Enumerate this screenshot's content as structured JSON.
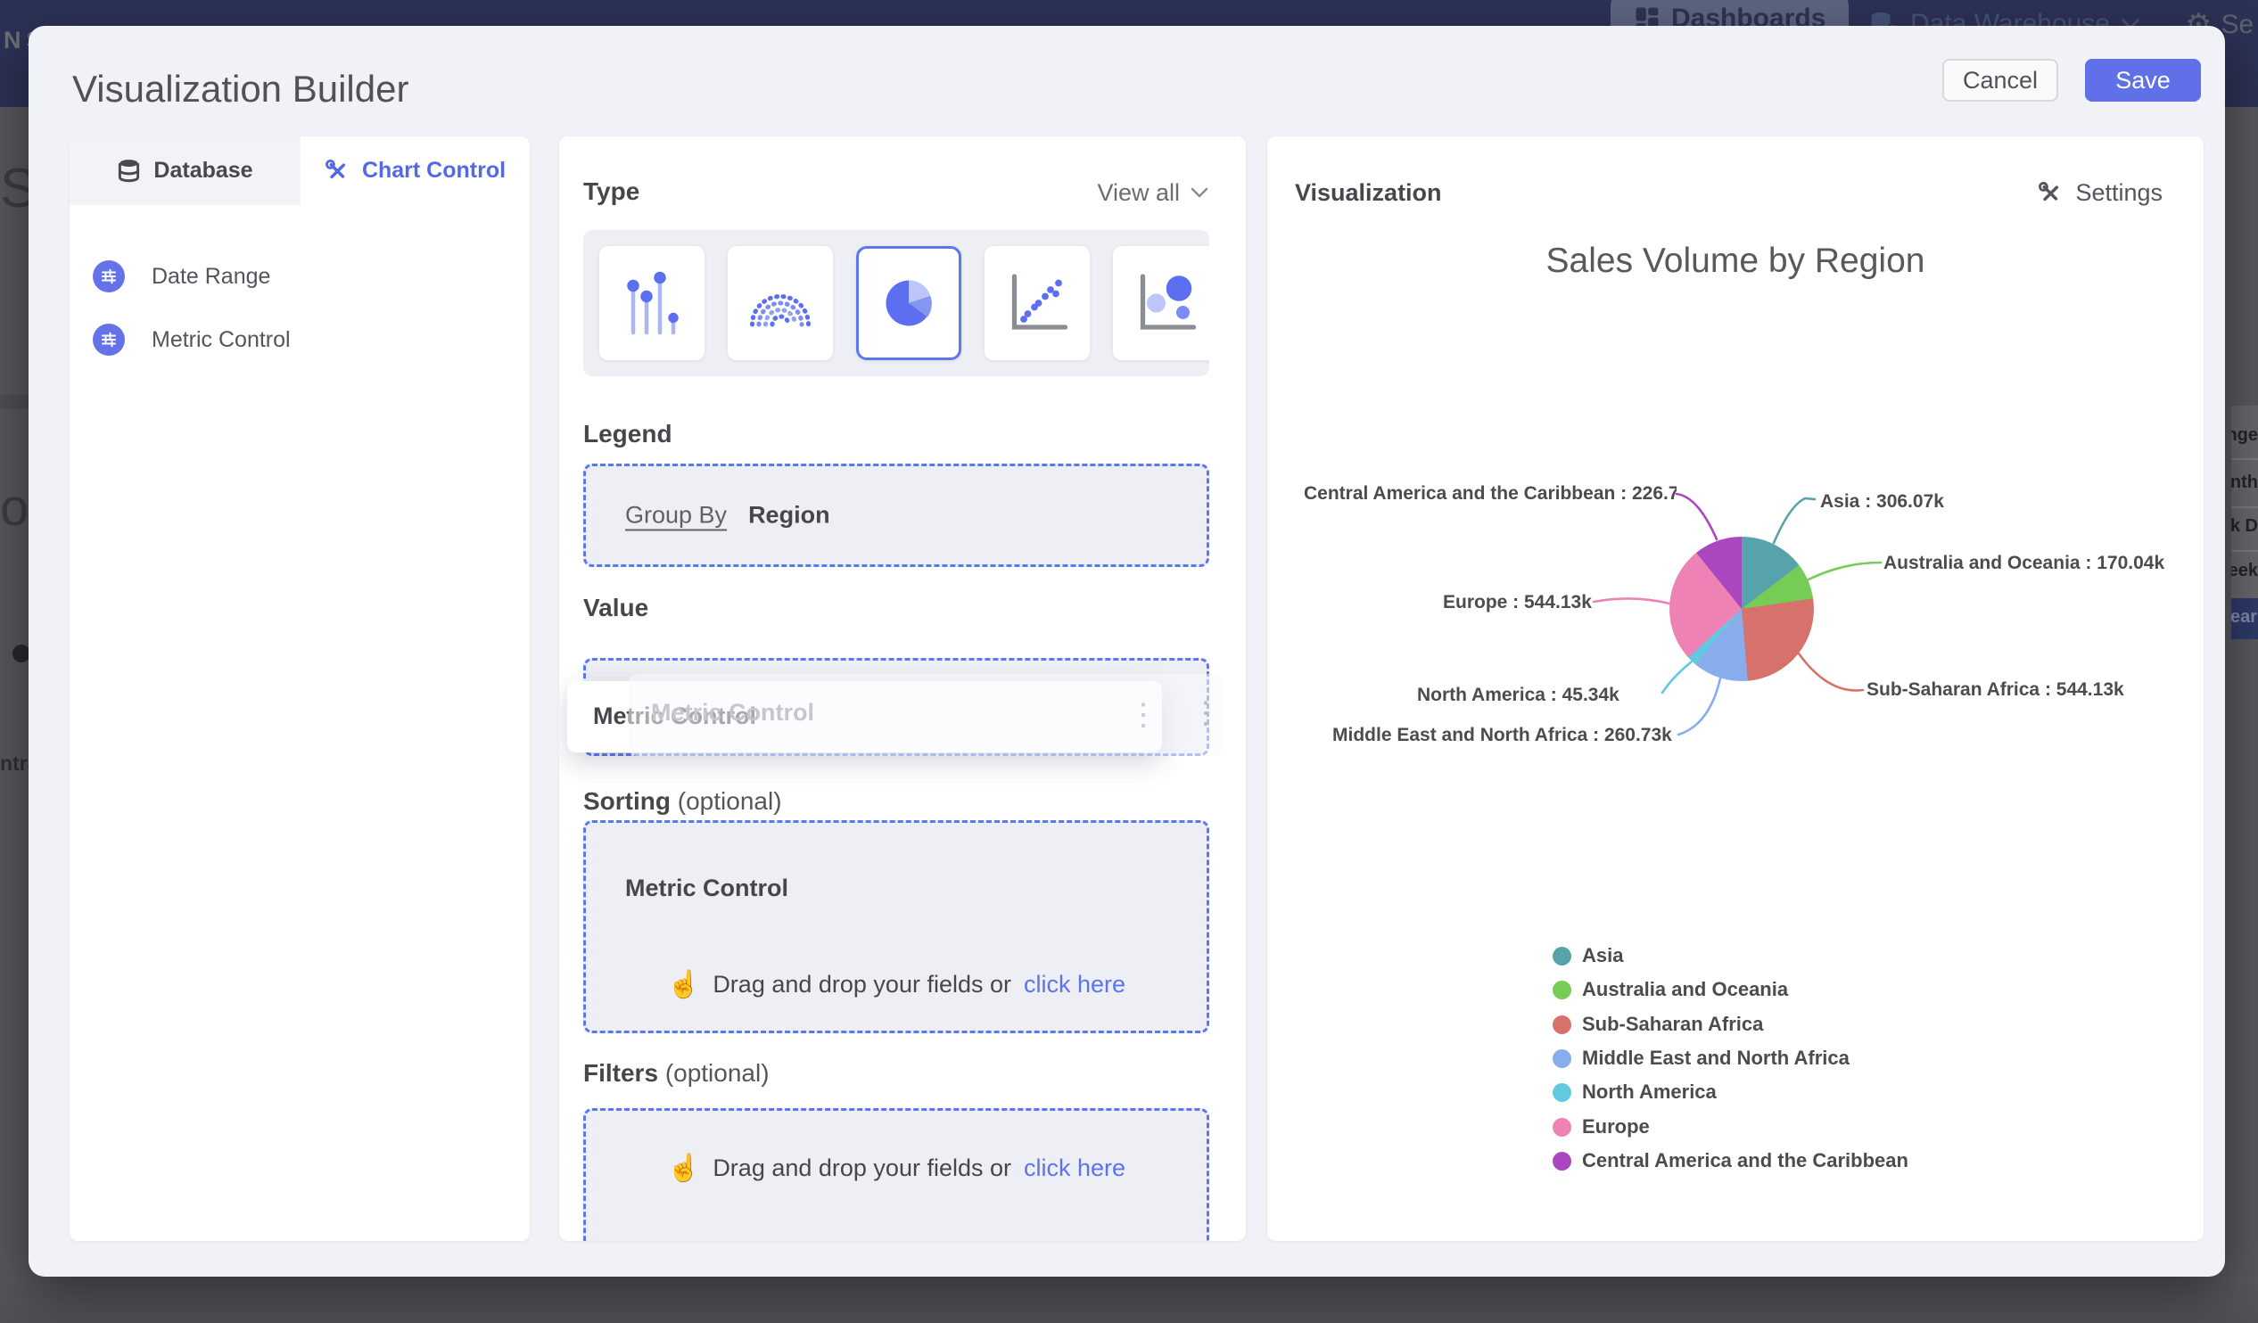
{
  "nav": {
    "brand": "NSIDER",
    "dashboards_label": "Dashboards",
    "data_warehouse_label": "Data Warehouse",
    "settings_partial": "Se"
  },
  "backdrop": {
    "fragment_top": "Sal",
    "fragment_mid": "ota",
    "fragment_bottom": "ntral",
    "right_menu_items": [
      "nge",
      "nth",
      "k D",
      "eek"
    ],
    "right_menu_selected": "ear"
  },
  "modal": {
    "title": "Visualization Builder",
    "cancel_label": "Cancel",
    "save_label": "Save"
  },
  "builder": {
    "tabs": [
      {
        "label": "Database",
        "active": false
      },
      {
        "label": "Chart Control",
        "active": true
      }
    ],
    "controls": [
      {
        "label": "Date Range"
      },
      {
        "label": "Metric Control"
      }
    ],
    "type": {
      "heading": "Type",
      "view_all": "View all",
      "options": [
        "lollipop",
        "arc-of-dots",
        "pie",
        "scatter",
        "bubble"
      ],
      "selected": "pie"
    },
    "legend": {
      "heading": "Legend",
      "group_by_label": "Group By",
      "group_by_value": "Region"
    },
    "value": {
      "heading": "Value",
      "chip_label": "Metric Control",
      "ghost_label": "Metric Control"
    },
    "sorting": {
      "heading": "Sorting",
      "optional": "(optional)",
      "chip_label": "Metric Control",
      "drop_text": "Drag and drop your fields or",
      "drop_link": "click here"
    },
    "filters": {
      "heading": "Filters",
      "optional": "(optional)",
      "drop_text": "Drag and drop your fields or",
      "drop_link": "click here"
    }
  },
  "viz": {
    "heading": "Visualization",
    "settings_label": "Settings"
  },
  "chart_data": {
    "type": "pie",
    "title": "Sales Volume by Region",
    "legend_position": "bottom-left",
    "labels_style": "outside with colored leader lines, clockwise from top",
    "series": [
      {
        "name": "Asia",
        "value": 306.07,
        "display": "306.07k",
        "color": "#56A3AB",
        "label": "Asia : 306.07k"
      },
      {
        "name": "Australia and Oceania",
        "value": 170.04,
        "display": "170.04k",
        "color": "#77CC55",
        "label": "Australia and Oceania : 170.04k"
      },
      {
        "name": "Sub-Saharan Africa",
        "value": 544.13,
        "display": "544.13k",
        "color": "#D7716B",
        "label": "Sub-Saharan Africa : 544.13k"
      },
      {
        "name": "Middle East and North Africa",
        "value": 260.73,
        "display": "260.73k",
        "color": "#88ACEC",
        "label": "Middle East and North Africa : 260.73k"
      },
      {
        "name": "North America",
        "value": 45.34,
        "display": "45.34k",
        "color": "#62C9E2",
        "label": "North America : 45.34k"
      },
      {
        "name": "Europe",
        "value": 544.13,
        "display": "544.13k",
        "color": "#EF82B5",
        "label": "Europe : 544.13k"
      },
      {
        "name": "Central America and the Caribbean",
        "value": 226.73,
        "display": "226.7",
        "color": "#AB47BE",
        "label": "Central America and the Caribbean : 226.7"
      }
    ]
  },
  "icons": {
    "kebab": "⋮",
    "gear": "⚙",
    "pointer": "☝"
  },
  "colors": {
    "accent_blue": "#5b74ee",
    "dashed_border": "#5b78f0",
    "save_bg": "#6070e8",
    "icon_circle": "#6474e8",
    "nav_bg": "#2c3256",
    "modal_bg": "#f1f2f7"
  }
}
